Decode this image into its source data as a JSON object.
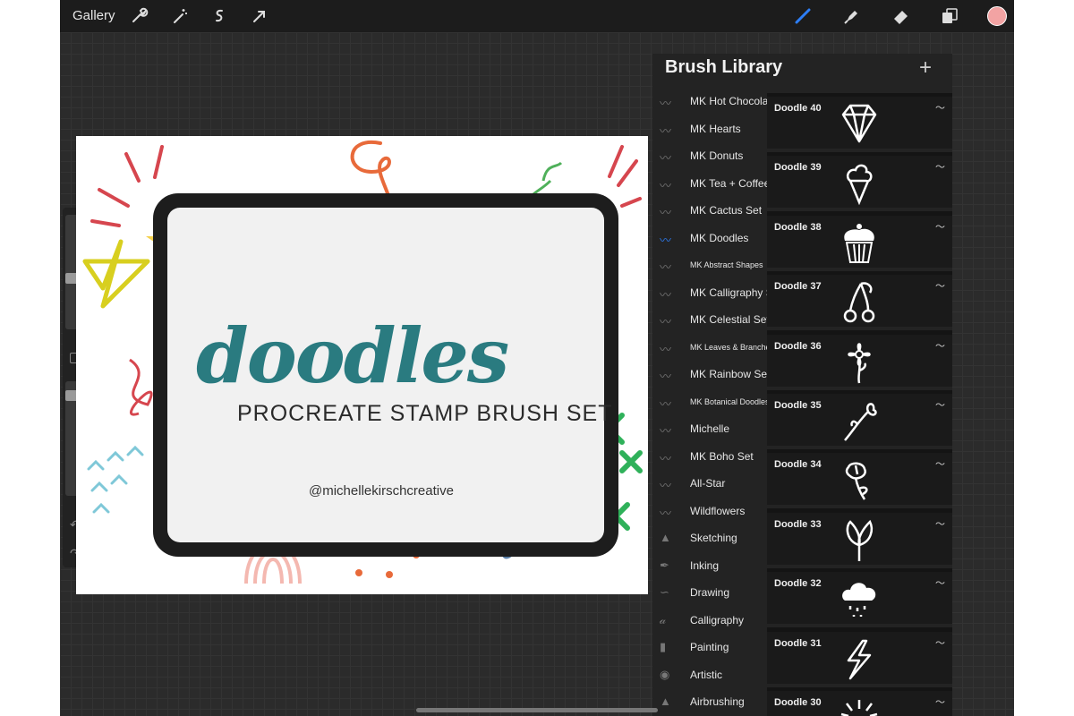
{
  "topbar": {
    "gallery": "Gallery",
    "left_tools": [
      "wrench-icon",
      "magic-wand-icon",
      "selection-icon",
      "transform-arrow-icon"
    ],
    "right_tools": [
      "brush-icon",
      "smudge-icon",
      "eraser-icon",
      "layers-icon"
    ],
    "color_swatch": "#f2a3a3",
    "active_tool_color": "#2d7ef7"
  },
  "canvas": {
    "title": "doodles",
    "subtitle": "PROCREATE STAMP BRUSH SET",
    "handle": "@michellekirschcreative"
  },
  "library": {
    "title": "Brush Library",
    "add_icon": "plus-icon",
    "categories": [
      {
        "label": "MK Hot Chocolate",
        "small": false,
        "icon": "stroke-icon"
      },
      {
        "label": "MK Hearts",
        "small": false,
        "icon": "stroke-icon"
      },
      {
        "label": "MK Donuts",
        "small": false,
        "icon": "stroke-icon"
      },
      {
        "label": "MK Tea + Coffee",
        "small": false,
        "icon": "stroke-icon"
      },
      {
        "label": "MK Cactus Set",
        "small": false,
        "icon": "stroke-icon"
      },
      {
        "label": "MK Doodles",
        "small": false,
        "icon": "stroke-icon",
        "active": true
      },
      {
        "label": "MK Abstract Shapes",
        "small": true,
        "icon": "stroke-icon"
      },
      {
        "label": "MK Calligraphy Set",
        "small": false,
        "icon": "stroke-icon"
      },
      {
        "label": "MK Celestial Set",
        "small": false,
        "icon": "stroke-icon"
      },
      {
        "label": "MK Leaves & Branches",
        "small": true,
        "icon": "stroke-icon"
      },
      {
        "label": "MK Rainbow Set",
        "small": false,
        "icon": "stroke-icon"
      },
      {
        "label": "MK Botanical Doodles",
        "small": true,
        "icon": "stroke-icon"
      },
      {
        "label": "Michelle",
        "small": false,
        "icon": "stroke-icon"
      },
      {
        "label": "MK Boho Set",
        "small": false,
        "icon": "stroke-icon"
      },
      {
        "label": "All-Star",
        "small": false,
        "icon": "stroke-icon"
      },
      {
        "label": "Wildflowers",
        "small": false,
        "icon": "stroke-icon"
      },
      {
        "label": "Sketching",
        "small": false,
        "icon": "pencil-tip-icon"
      },
      {
        "label": "Inking",
        "small": false,
        "icon": "pen-nib-icon"
      },
      {
        "label": "Drawing",
        "small": false,
        "icon": "squiggle-icon"
      },
      {
        "label": "Calligraphy",
        "small": false,
        "icon": "calligraphy-a-icon"
      },
      {
        "label": "Painting",
        "small": false,
        "icon": "paintbrush-icon"
      },
      {
        "label": "Artistic",
        "small": false,
        "icon": "palette-icon"
      },
      {
        "label": "Airbrushing",
        "small": false,
        "icon": "airbrush-icon"
      }
    ],
    "brushes": [
      {
        "name": "Doodle 40",
        "icon": "diamond-icon"
      },
      {
        "name": "Doodle 39",
        "icon": "ice-cream-icon"
      },
      {
        "name": "Doodle 38",
        "icon": "cupcake-icon"
      },
      {
        "name": "Doodle 37",
        "icon": "cherries-icon"
      },
      {
        "name": "Doodle 36",
        "icon": "flower-icon"
      },
      {
        "name": "Doodle 35",
        "icon": "sprig-icon"
      },
      {
        "name": "Doodle 34",
        "icon": "tulip-icon"
      },
      {
        "name": "Doodle 33",
        "icon": "leaves-icon"
      },
      {
        "name": "Doodle 32",
        "icon": "rain-cloud-icon"
      },
      {
        "name": "Doodle 31",
        "icon": "lightning-icon"
      },
      {
        "name": "Doodle 30",
        "icon": "sunburst-icon"
      }
    ]
  }
}
